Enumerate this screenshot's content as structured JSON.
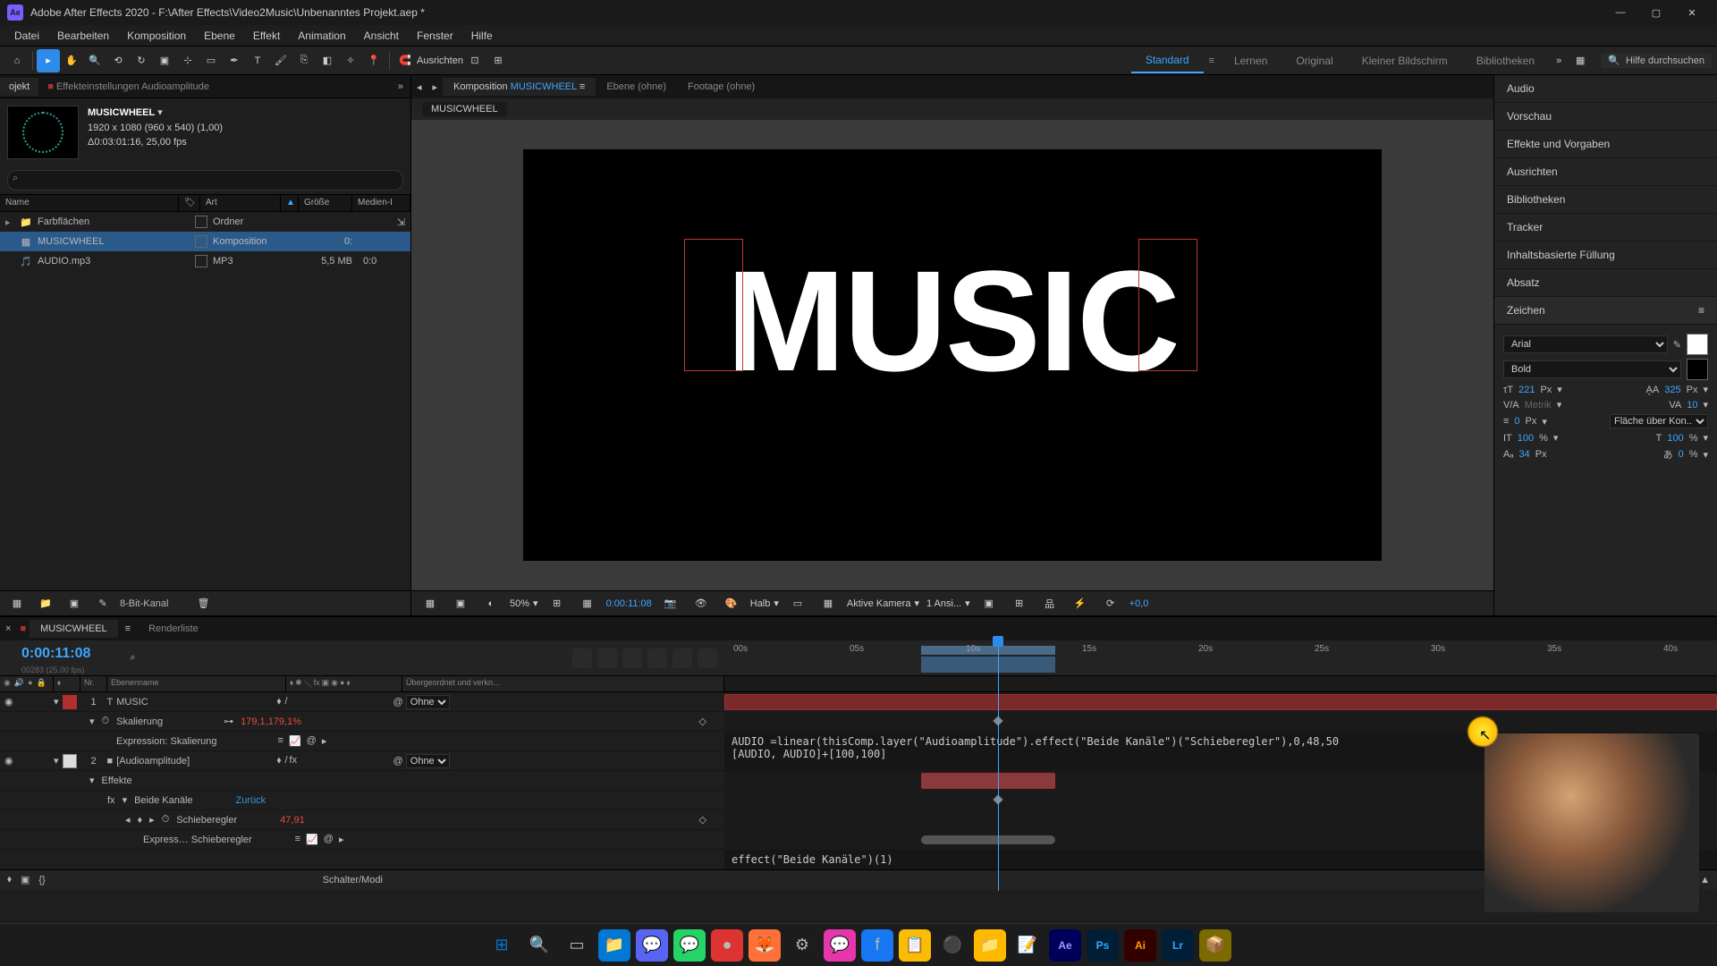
{
  "app": {
    "title": "Adobe After Effects 2020 - F:\\After Effects\\Video2Music\\Unbenanntes Projekt.aep *"
  },
  "menu": [
    "Datei",
    "Bearbeiten",
    "Komposition",
    "Ebene",
    "Effekt",
    "Animation",
    "Ansicht",
    "Fenster",
    "Hilfe"
  ],
  "toolbar": {
    "snap": "Ausrichten",
    "workspaces": [
      "Standard",
      "Lernen",
      "Original",
      "Kleiner Bildschirm",
      "Bibliotheken"
    ],
    "active_workspace": "Standard",
    "search_placeholder": "Hilfe durchsuchen"
  },
  "project_panel": {
    "tabs": [
      "ojekt",
      "Effekteinstellungen Audioamplitude"
    ],
    "comp_name": "MUSICWHEEL",
    "dims": "1920 x 1080 (960 x 540) (1,00)",
    "dur": "Δ0:03:01:16, 25,00 fps",
    "cols": {
      "name": "Name",
      "type": "Art",
      "size": "Größe",
      "media": "Medien-I"
    },
    "assets": [
      {
        "name": "Farbflächen",
        "type": "Ordner",
        "size": "",
        "sel": false,
        "icon": "folder"
      },
      {
        "name": "MUSICWHEEL",
        "type": "Komposition",
        "size": "0:",
        "sel": true,
        "icon": "comp"
      },
      {
        "name": "AUDIO.mp3",
        "type": "MP3",
        "size": "5,5 MB",
        "extra": "0:0",
        "sel": false,
        "icon": "audio"
      }
    ],
    "footer_depth": "8-Bit-Kanal"
  },
  "comp_panel": {
    "tabs": [
      {
        "prefix": "Komposition",
        "name": "MUSICWHEEL",
        "active": true
      },
      {
        "prefix": "Ebene",
        "name": "(ohne)",
        "active": false
      },
      {
        "prefix": "Footage",
        "name": "(ohne)",
        "active": false
      }
    ],
    "crumb": "MUSICWHEEL",
    "text": "MUSIC",
    "footer": {
      "zoom": "50%",
      "time": "0:00:11:08",
      "res": "Halb",
      "camera": "Aktive Kamera",
      "views": "1 Ansi...",
      "exp": "+0,0"
    }
  },
  "right_panels": [
    "Audio",
    "Vorschau",
    "Effekte und Vorgaben",
    "Ausrichten",
    "Bibliotheken",
    "Tracker",
    "Inhaltsbasierte Füllung",
    "Absatz",
    "Zeichen"
  ],
  "char_panel": {
    "font": "Arial",
    "weight": "Bold",
    "size": "221",
    "size_unit": "Px",
    "leading": "325",
    "leading_unit": "Px",
    "kerning": "Metrik",
    "tracking": "10",
    "stroke": "0",
    "stroke_unit": "Px",
    "stroke_mode": "Fläche über Kon...",
    "vscale": "100",
    "vscale_unit": "%",
    "hscale": "100",
    "hscale_unit": "%",
    "baseline": "34",
    "baseline_unit": "Px",
    "tsume": "0",
    "tsume_unit": "%"
  },
  "timeline": {
    "tab": "MUSICWHEEL",
    "tab2": "Renderliste",
    "time": "0:00:11:08",
    "frame_info": "00283 (25.00 fps)",
    "cols": {
      "nr": "Nr.",
      "name": "Ebenenname",
      "parent": "Übergeordnet und verkn..."
    },
    "ruler": [
      "00s",
      "05s",
      "10s",
      "15s",
      "20s",
      "25s",
      "30s",
      "35s",
      "40s"
    ],
    "layers": [
      {
        "num": "1",
        "name": "MUSIC",
        "type": "text",
        "color": "#b03030",
        "parent": "Ohne"
      },
      {
        "num": "2",
        "name": "[Audioamplitude]",
        "type": "solid",
        "color": "#ddd",
        "parent": "Ohne"
      }
    ],
    "props": {
      "skalierung": "Skalierung",
      "skalierung_val": "179,1,179,1%",
      "expr_label": "Expression: Skalierung",
      "effekte": "Effekte",
      "beide": "Beide Kanäle",
      "zuruck": "Zurück",
      "schiebe": "Schieberegler",
      "schiebe_val": "47,91",
      "expr2_label": "Express… Schieberegler"
    },
    "expr1": "AUDIO =linear(thisComp.layer(\"Audioamplitude\").effect(\"Beide Kanäle\")(\"Schieberegler\"),0,48,50\n[AUDIO, AUDIO]+[100,100]",
    "expr2": "effect(\"Beide Kanäle\")(1)",
    "footer": "Schalter/Modi"
  }
}
